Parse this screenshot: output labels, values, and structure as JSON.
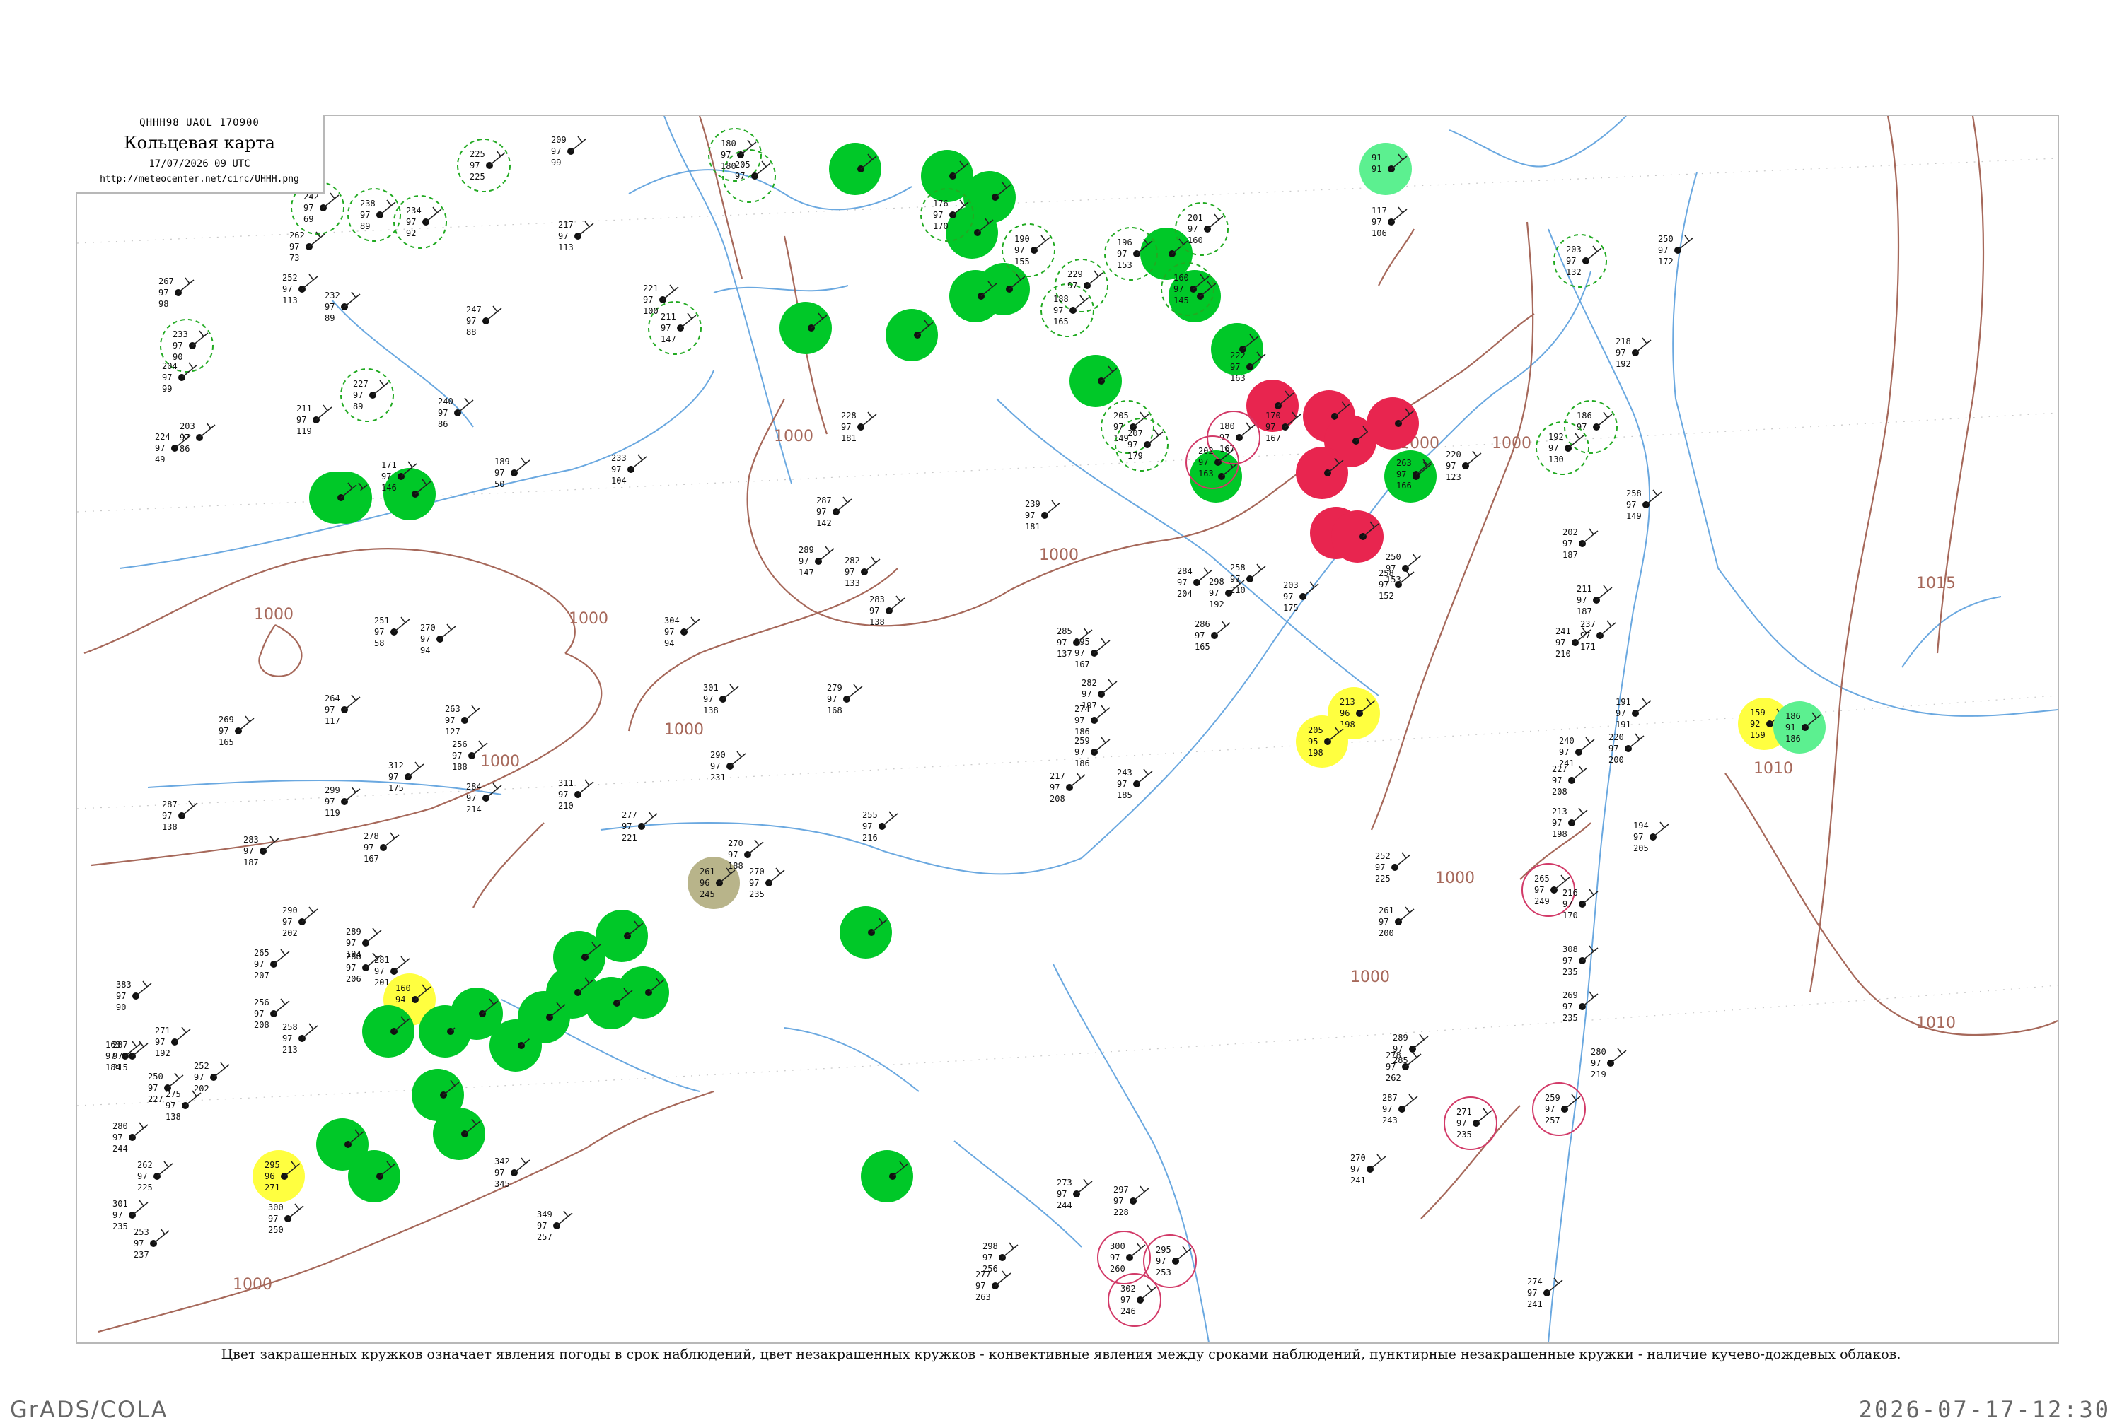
{
  "legend": {
    "code": "QHHH98  UAOL  170900",
    "title": "Кольцевая карта",
    "datetime": "17/07/2026 09 UTC",
    "url": "http://meteocenter.net/circ/UHHH.png"
  },
  "caption": "Цвет закрашенных кружков означает явления погоды в срок наблюдений, цвет незакрашенных кружков - конвективные явления между сроками наблюдений, пунктирные незакрашенные кружки - наличие кучево-дождевых облаков.",
  "footer": {
    "left": "GrADS/COLA",
    "right": "2026-07-17-12:30"
  },
  "colors": {
    "rain": "#00c828",
    "thunderstorm": "#e8254f",
    "fog_haze": "#ffff40",
    "drizzle": "#5cf090",
    "dust": "#b8b48a",
    "cb_dashed": "#22aa22",
    "isobar": "#a6685a",
    "river": "#6aa8e0"
  },
  "isobar_labels": [
    {
      "text": "1000"
    },
    {
      "text": "1000"
    },
    {
      "text": "1000"
    },
    {
      "text": "1000"
    },
    {
      "text": "1000"
    },
    {
      "text": "1000"
    },
    {
      "text": "1000"
    },
    {
      "text": "1000"
    },
    {
      "text": "1000"
    },
    {
      "text": "1000"
    },
    {
      "text": "1015"
    },
    {
      "text": "1010"
    },
    {
      "text": "1010"
    },
    {
      "text": "1000"
    }
  ],
  "filled_stations": [
    {
      "kind": "rain",
      "obs": [
        "",
        "",
        ""
      ]
    },
    {
      "kind": "rain",
      "obs": [
        "",
        "",
        ""
      ]
    },
    {
      "kind": "rain",
      "obs": [
        "",
        "",
        ""
      ]
    },
    {
      "kind": "rain",
      "obs": [
        "",
        "",
        ""
      ]
    },
    {
      "kind": "rain",
      "obs": [
        "",
        "",
        ""
      ]
    },
    {
      "kind": "rain",
      "obs": [
        "",
        "",
        ""
      ]
    },
    {
      "kind": "rain",
      "obs": [
        "",
        "",
        ""
      ]
    },
    {
      "kind": "rain",
      "obs": [
        "",
        "",
        ""
      ]
    },
    {
      "kind": "rain",
      "obs": [
        "",
        "",
        ""
      ]
    },
    {
      "kind": "rain",
      "obs": [
        "",
        "",
        ""
      ]
    },
    {
      "kind": "rain",
      "obs": [
        "",
        "",
        ""
      ]
    },
    {
      "kind": "thunderstorm",
      "obs": [
        "",
        "",
        ""
      ]
    },
    {
      "kind": "thunderstorm",
      "obs": [
        "",
        "",
        ""
      ]
    },
    {
      "kind": "thunderstorm",
      "obs": [
        "",
        "",
        ""
      ]
    },
    {
      "kind": "thunderstorm",
      "obs": [
        "",
        "",
        ""
      ]
    },
    {
      "kind": "thunderstorm",
      "obs": [
        "",
        "",
        ""
      ]
    },
    {
      "kind": "rain",
      "obs": [
        "",
        "",
        ""
      ]
    },
    {
      "kind": "drizzle",
      "obs": [
        "91",
        "91",
        ""
      ]
    },
    {
      "kind": "thunderstorm",
      "obs": [
        "",
        "",
        ""
      ]
    },
    {
      "kind": "rain",
      "obs": [
        "",
        "",
        ""
      ]
    },
    {
      "kind": "thunderstorm",
      "obs": [
        "",
        "",
        ""
      ]
    },
    {
      "kind": "fog_haze",
      "obs": [
        "213",
        "96",
        "198"
      ]
    },
    {
      "kind": "fog_haze",
      "obs": [
        "205",
        "95",
        "198"
      ]
    },
    {
      "kind": "fog_haze",
      "obs": [
        "159",
        "92",
        "159"
      ]
    },
    {
      "kind": "drizzle",
      "obs": [
        "186",
        "91",
        "186"
      ]
    },
    {
      "kind": "dust",
      "obs": [
        "261",
        "96",
        "245"
      ]
    },
    {
      "kind": "rain",
      "obs": [
        "",
        "",
        ""
      ]
    },
    {
      "kind": "rain",
      "obs": [
        "",
        "",
        ""
      ]
    },
    {
      "kind": "rain",
      "obs": [
        "",
        "",
        ""
      ]
    },
    {
      "kind": "rain",
      "obs": [
        "",
        "",
        ""
      ]
    },
    {
      "kind": "rain",
      "obs": [
        "",
        "",
        ""
      ]
    },
    {
      "kind": "rain",
      "obs": [
        "",
        "",
        ""
      ]
    },
    {
      "kind": "rain",
      "obs": [
        "",
        "",
        ""
      ]
    },
    {
      "kind": "rain",
      "obs": [
        "",
        "",
        ""
      ]
    },
    {
      "kind": "rain",
      "obs": [
        "",
        "",
        ""
      ]
    },
    {
      "kind": "rain",
      "obs": [
        "",
        "",
        ""
      ]
    },
    {
      "kind": "fog_haze",
      "obs": [
        "160",
        "94",
        ""
      ]
    },
    {
      "kind": "rain",
      "obs": [
        "",
        "",
        ""
      ]
    },
    {
      "kind": "rain",
      "obs": [
        "",
        "",
        ""
      ]
    },
    {
      "kind": "rain",
      "obs": [
        "",
        "",
        ""
      ]
    },
    {
      "kind": "rain",
      "obs": [
        "",
        "",
        ""
      ]
    },
    {
      "kind": "rain",
      "obs": [
        "",
        "",
        ""
      ]
    },
    {
      "kind": "rain",
      "obs": [
        "",
        "",
        ""
      ]
    },
    {
      "kind": "rain",
      "obs": [
        "",
        "",
        ""
      ]
    },
    {
      "kind": "fog_haze",
      "obs": [
        "295",
        "96",
        "271"
      ]
    },
    {
      "kind": "rain",
      "obs": [
        "",
        "",
        ""
      ]
    },
    {
      "kind": "rain",
      "obs": [
        "",
        "",
        ""
      ]
    },
    {
      "kind": "rain",
      "obs": [
        "",
        "",
        ""
      ]
    }
  ],
  "dashed_stations": [
    {
      "obs": [
        "225",
        "97",
        "225"
      ]
    },
    {
      "obs": [
        "180",
        "97",
        "180"
      ]
    },
    {
      "obs": [
        "205",
        "97",
        ""
      ]
    },
    {
      "obs": [
        "242",
        "97",
        "69"
      ]
    },
    {
      "obs": [
        "238",
        "97",
        "89"
      ]
    },
    {
      "obs": [
        "234",
        "97",
        "92"
      ]
    },
    {
      "obs": [
        "233",
        "97",
        "90"
      ]
    },
    {
      "obs": [
        "227",
        "97",
        "89"
      ]
    },
    {
      "obs": [
        "190",
        "97",
        "155"
      ]
    },
    {
      "obs": [
        "176",
        "97",
        "170"
      ]
    },
    {
      "obs": [
        "229",
        "97",
        ""
      ]
    },
    {
      "obs": [
        "196",
        "97",
        "153"
      ]
    },
    {
      "obs": [
        "160",
        "97",
        "145"
      ]
    },
    {
      "obs": [
        "201",
        "97",
        "160"
      ]
    },
    {
      "obs": [
        "205",
        "97",
        "149"
      ]
    },
    {
      "obs": [
        "207",
        "97",
        "179"
      ]
    },
    {
      "obs": [
        "188",
        "97",
        "165"
      ]
    },
    {
      "obs": [
        "186",
        "97",
        ""
      ]
    },
    {
      "obs": [
        "203",
        "97",
        "132"
      ]
    },
    {
      "obs": [
        "192",
        "97",
        "130"
      ]
    },
    {
      "obs": [
        "211",
        "97",
        "147"
      ]
    }
  ],
  "red_ring_stations": [
    {
      "obs": [
        "180",
        "97",
        "167"
      ]
    },
    {
      "obs": [
        "202",
        "97",
        "163"
      ]
    },
    {
      "obs": [
        "265",
        "97",
        "249"
      ]
    },
    {
      "obs": [
        "259",
        "97",
        "257"
      ]
    },
    {
      "obs": [
        "271",
        "97",
        "235"
      ]
    },
    {
      "obs": [
        "300",
        "97",
        "260"
      ]
    },
    {
      "obs": [
        "302",
        "97",
        "246"
      ]
    },
    {
      "obs": [
        "295",
        "97",
        "253"
      ]
    }
  ],
  "plain_stations": [
    {
      "obs": [
        "267",
        "97",
        "98"
      ]
    },
    {
      "obs": [
        "224",
        "97",
        "49"
      ]
    },
    {
      "obs": [
        "203",
        "97",
        "86"
      ]
    },
    {
      "obs": [
        "204",
        "97",
        "99"
      ]
    },
    {
      "obs": [
        "211",
        "97",
        "119"
      ]
    },
    {
      "obs": [
        "262",
        "97",
        "73"
      ]
    },
    {
      "obs": [
        "252",
        "97",
        "113"
      ]
    },
    {
      "obs": [
        "232",
        "97",
        "89"
      ]
    },
    {
      "obs": [
        "240",
        "97",
        "86"
      ]
    },
    {
      "obs": [
        "247",
        "97",
        "88"
      ]
    },
    {
      "obs": [
        "209",
        "97",
        "99"
      ]
    },
    {
      "obs": [
        "217",
        "97",
        "113"
      ]
    },
    {
      "obs": [
        "221",
        "97",
        "100"
      ]
    },
    {
      "obs": [
        "189",
        "97",
        "50"
      ]
    },
    {
      "obs": [
        "171",
        "97",
        "146"
      ]
    },
    {
      "obs": [
        "233",
        "97",
        "104"
      ]
    },
    {
      "obs": [
        "287",
        "97",
        "142"
      ]
    },
    {
      "obs": [
        "289",
        "97",
        "147"
      ]
    },
    {
      "obs": [
        "282",
        "97",
        "133"
      ]
    },
    {
      "obs": [
        "283",
        "97",
        "138"
      ]
    },
    {
      "obs": [
        "304",
        "97",
        "94"
      ]
    },
    {
      "obs": [
        "251",
        "97",
        "58"
      ]
    },
    {
      "obs": [
        "270",
        "97",
        "94"
      ]
    },
    {
      "obs": [
        "264",
        "97",
        "117"
      ]
    },
    {
      "obs": [
        "263",
        "97",
        "127"
      ]
    },
    {
      "obs": [
        "256",
        "97",
        "188"
      ]
    },
    {
      "obs": [
        "269",
        "97",
        "165"
      ]
    },
    {
      "obs": [
        "284",
        "97",
        "214"
      ]
    },
    {
      "obs": [
        "299",
        "97",
        "119"
      ]
    },
    {
      "obs": [
        "312",
        "97",
        "175"
      ]
    },
    {
      "obs": [
        "287",
        "97",
        "138"
      ]
    },
    {
      "obs": [
        "278",
        "97",
        "167"
      ]
    },
    {
      "obs": [
        "283",
        "97",
        "187"
      ]
    },
    {
      "obs": [
        "301",
        "97",
        "138"
      ]
    },
    {
      "obs": [
        "290",
        "97",
        "231"
      ]
    },
    {
      "obs": [
        "279",
        "97",
        "168"
      ]
    },
    {
      "obs": [
        "311",
        "97",
        "210"
      ]
    },
    {
      "obs": [
        "255",
        "97",
        "216"
      ]
    },
    {
      "obs": [
        "277",
        "97",
        "221"
      ]
    },
    {
      "obs": [
        "270",
        "97",
        "188"
      ]
    },
    {
      "obs": [
        "290",
        "97",
        "202"
      ]
    },
    {
      "obs": [
        "289",
        "97",
        "194"
      ]
    },
    {
      "obs": [
        "288",
        "97",
        "206"
      ]
    },
    {
      "obs": [
        "281",
        "97",
        "201"
      ]
    },
    {
      "obs": [
        "270",
        "97",
        "235"
      ]
    },
    {
      "obs": [
        "265",
        "97",
        "207"
      ]
    },
    {
      "obs": [
        "256",
        "97",
        "208"
      ]
    },
    {
      "obs": [
        "258",
        "97",
        "213"
      ]
    },
    {
      "obs": [
        "271",
        "97",
        "192"
      ]
    },
    {
      "obs": [
        "287",
        "97",
        "215"
      ]
    },
    {
      "obs": [
        "250",
        "97",
        "227"
      ]
    },
    {
      "obs": [
        "252",
        "97",
        "202"
      ]
    },
    {
      "obs": [
        "275",
        "97",
        "138"
      ]
    },
    {
      "obs": [
        "280",
        "97",
        "244"
      ]
    },
    {
      "obs": [
        "262",
        "97",
        "225"
      ]
    },
    {
      "obs": [
        "301",
        "97",
        "235"
      ]
    },
    {
      "obs": [
        "253",
        "97",
        "237"
      ]
    },
    {
      "obs": [
        "300",
        "97",
        "250"
      ]
    },
    {
      "obs": [
        "342",
        "97",
        "345"
      ]
    },
    {
      "obs": [
        "349",
        "97",
        "257"
      ]
    },
    {
      "obs": [
        "383",
        "97",
        "90"
      ]
    },
    {
      "obs": [
        "163",
        "97",
        "184"
      ]
    },
    {
      "obs": [
        "228",
        "97",
        "181"
      ]
    },
    {
      "obs": [
        "239",
        "97",
        "181"
      ]
    },
    {
      "obs": [
        "285",
        "97",
        "137"
      ]
    },
    {
      "obs": [
        "295",
        "97",
        "167"
      ]
    },
    {
      "obs": [
        "282",
        "97",
        "197"
      ]
    },
    {
      "obs": [
        "274",
        "97",
        "186"
      ]
    },
    {
      "obs": [
        "259",
        "97",
        "186"
      ]
    },
    {
      "obs": [
        "217",
        "97",
        "208"
      ]
    },
    {
      "obs": [
        "243",
        "97",
        "185"
      ]
    },
    {
      "obs": [
        "298",
        "97",
        "192"
      ]
    },
    {
      "obs": [
        "286",
        "97",
        "165"
      ]
    },
    {
      "obs": [
        "284",
        "97",
        "204"
      ]
    },
    {
      "obs": [
        "203",
        "97",
        "175"
      ]
    },
    {
      "obs": [
        "258",
        "97",
        "152"
      ]
    },
    {
      "obs": [
        "263",
        "97",
        "166"
      ]
    },
    {
      "obs": [
        "250",
        "97",
        "153"
      ]
    },
    {
      "obs": [
        "220",
        "97",
        "123"
      ]
    },
    {
      "obs": [
        "241",
        "97",
        "210"
      ]
    },
    {
      "obs": [
        "240",
        "97",
        "241"
      ]
    },
    {
      "obs": [
        "227",
        "97",
        "208"
      ]
    },
    {
      "obs": [
        "252",
        "97",
        "225"
      ]
    },
    {
      "obs": [
        "261",
        "97",
        "200"
      ]
    },
    {
      "obs": [
        "213",
        "97",
        "198"
      ]
    },
    {
      "obs": [
        "220",
        "97",
        "200"
      ]
    },
    {
      "obs": [
        "191",
        "97",
        "191"
      ]
    },
    {
      "obs": [
        "237",
        "97",
        "171"
      ]
    },
    {
      "obs": [
        "258",
        "97",
        "149"
      ]
    },
    {
      "obs": [
        "250",
        "97",
        "172"
      ]
    },
    {
      "obs": [
        "218",
        "97",
        "192"
      ]
    },
    {
      "obs": [
        "202",
        "97",
        "187"
      ]
    },
    {
      "obs": [
        "211",
        "97",
        "187"
      ]
    },
    {
      "obs": [
        "194",
        "97",
        "205"
      ]
    },
    {
      "obs": [
        "216",
        "97",
        "170"
      ]
    },
    {
      "obs": [
        "308",
        "97",
        "235"
      ]
    },
    {
      "obs": [
        "269",
        "97",
        "235"
      ]
    },
    {
      "obs": [
        "280",
        "97",
        "219"
      ]
    },
    {
      "obs": [
        "289",
        "97",
        "285"
      ]
    },
    {
      "obs": [
        "278",
        "97",
        "262"
      ]
    },
    {
      "obs": [
        "270",
        "97",
        "241"
      ]
    },
    {
      "obs": [
        "287",
        "97",
        "243"
      ]
    },
    {
      "obs": [
        "273",
        "97",
        "244"
      ]
    },
    {
      "obs": [
        "297",
        "97",
        "228"
      ]
    },
    {
      "obs": [
        "298",
        "97",
        "256"
      ]
    },
    {
      "obs": [
        "277",
        "97",
        "263"
      ]
    },
    {
      "obs": [
        "274",
        "97",
        "241"
      ]
    },
    {
      "obs": [
        "222",
        "97",
        "163"
      ]
    },
    {
      "obs": [
        "170",
        "97",
        "167"
      ]
    },
    {
      "obs": [
        "117",
        "97",
        "106"
      ]
    },
    {
      "obs": [
        "258",
        "97",
        "210"
      ]
    }
  ]
}
